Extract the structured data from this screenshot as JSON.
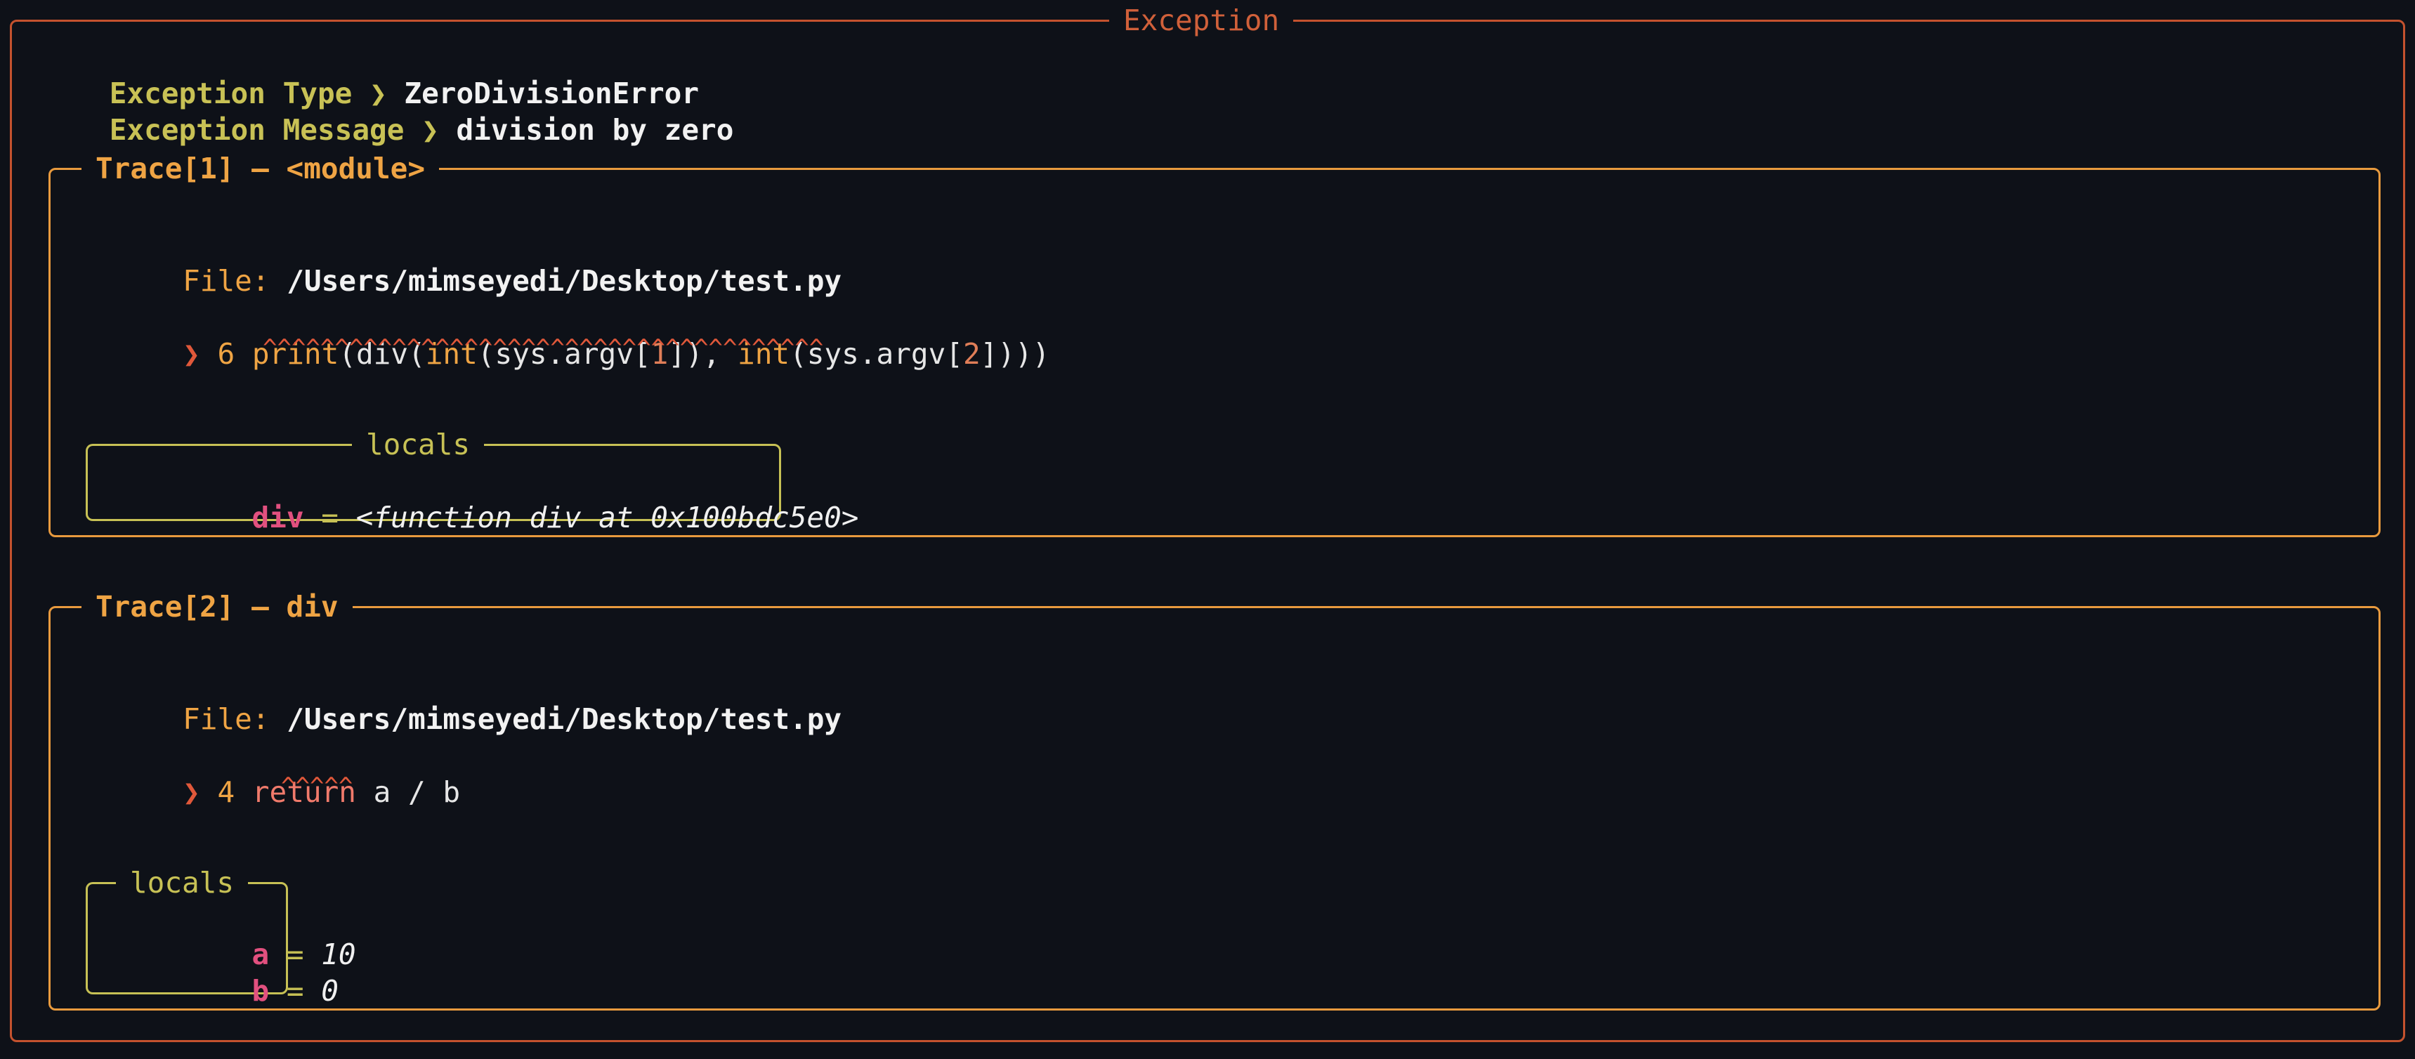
{
  "exception": {
    "panel_title": "Exception",
    "type_label": "Exception Type",
    "type_value": "ZeroDivisionError",
    "message_label": "Exception Message",
    "message_value": "division by zero",
    "separator": "❯"
  },
  "traces": [
    {
      "title": "Trace[1] – <module>",
      "file_label": "File:",
      "file_path": "/Users/mimseyedi/Desktop/test.py",
      "marker": "❯",
      "line_no": "6",
      "code": {
        "t1": "print",
        "t2": "(div(",
        "t3": "int",
        "t4": "(sys.argv[",
        "t5": "1",
        "t6": "]), ",
        "t7": "int",
        "t8": "(sys.argv[",
        "t9": "2",
        "t10": "])))"
      },
      "carets": "^^^^^^^^^^^^^^^^^^^^^^^^^^^^^^^^^^^^^^^",
      "locals_title": "locals",
      "locals": [
        {
          "name": "div",
          "eq": "=",
          "value": "<function div at 0x100bdc5e0>"
        }
      ]
    },
    {
      "title": "Trace[2] – div",
      "file_label": "File:",
      "file_path": "/Users/mimseyedi/Desktop/test.py",
      "marker": "❯",
      "line_no": "4",
      "code": {
        "keyword": "return",
        "rest": " a / b"
      },
      "carets": "^^^^^",
      "locals_title": "locals",
      "locals": [
        {
          "name": "a",
          "eq": "=",
          "value": "10"
        },
        {
          "name": "b",
          "eq": "=",
          "value": "0"
        }
      ]
    }
  ],
  "colors": {
    "background": "#0e1118",
    "outer_border": "#c4522e",
    "trace_border": "#e89a3e",
    "locals_border": "#c7c155",
    "local_name": "#e2507f"
  }
}
